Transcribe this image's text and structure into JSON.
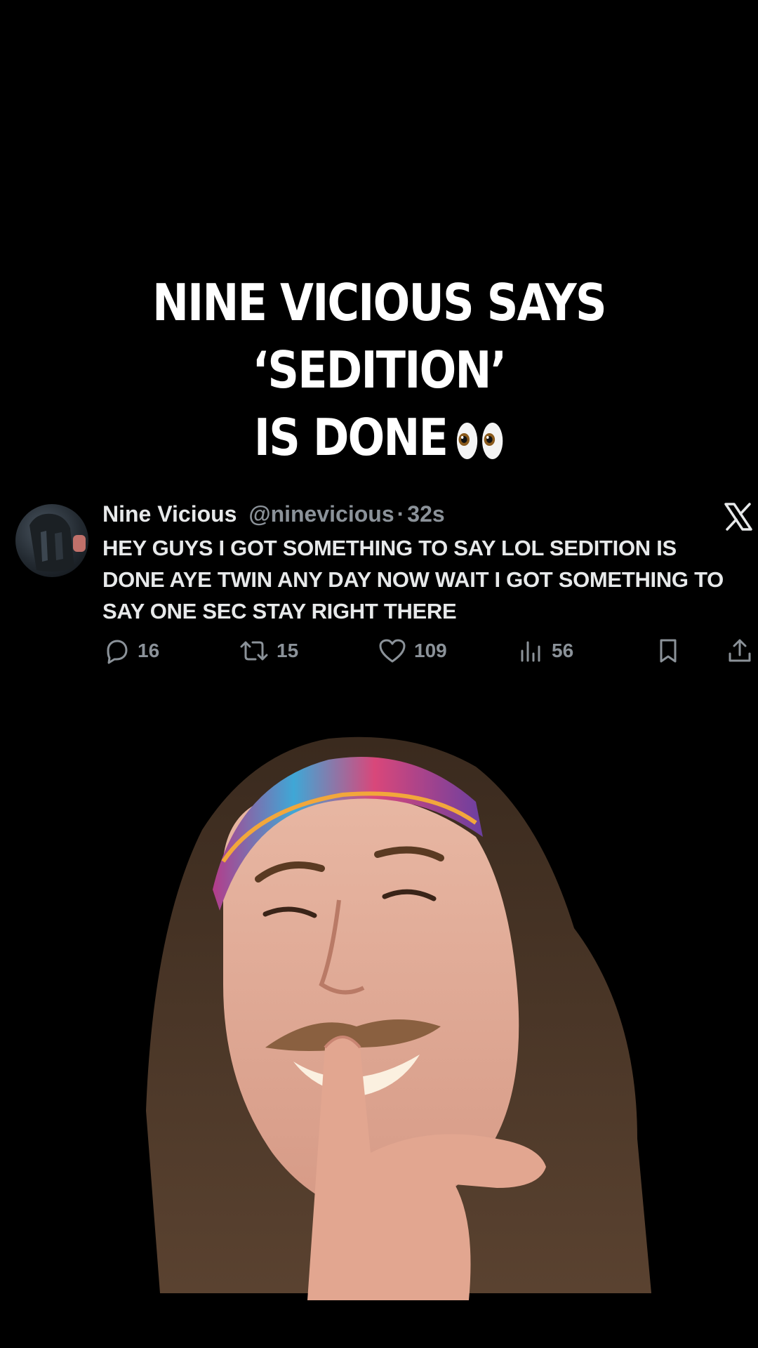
{
  "headline": {
    "line1": "NINE VICIOUS SAYS ‘SEDITION’",
    "line2": "IS DONE",
    "emoji": "eyes-emoji"
  },
  "tweet": {
    "display_name": "Nine Vicious",
    "handle": "@ninevicious",
    "separator": "·",
    "time": "32s",
    "text": "HEY GUYS I GOT SOMETHING TO SAY LOL SEDITION IS DONE AYE TWIN ANY DAY NOW WAIT I GOT SOMETHING TO SAY ONE SEC STAY RIGHT THERE",
    "platform_icon": "x-logo-icon",
    "actions": {
      "replies": "16",
      "reposts": "15",
      "likes": "109",
      "views": "56"
    }
  },
  "photo": {
    "subject": "person-with-headband-shushing"
  },
  "colors": {
    "background": "#000000",
    "text_primary": "#e7e9ea",
    "text_secondary": "#8b9299",
    "headline": "#ffffff"
  }
}
